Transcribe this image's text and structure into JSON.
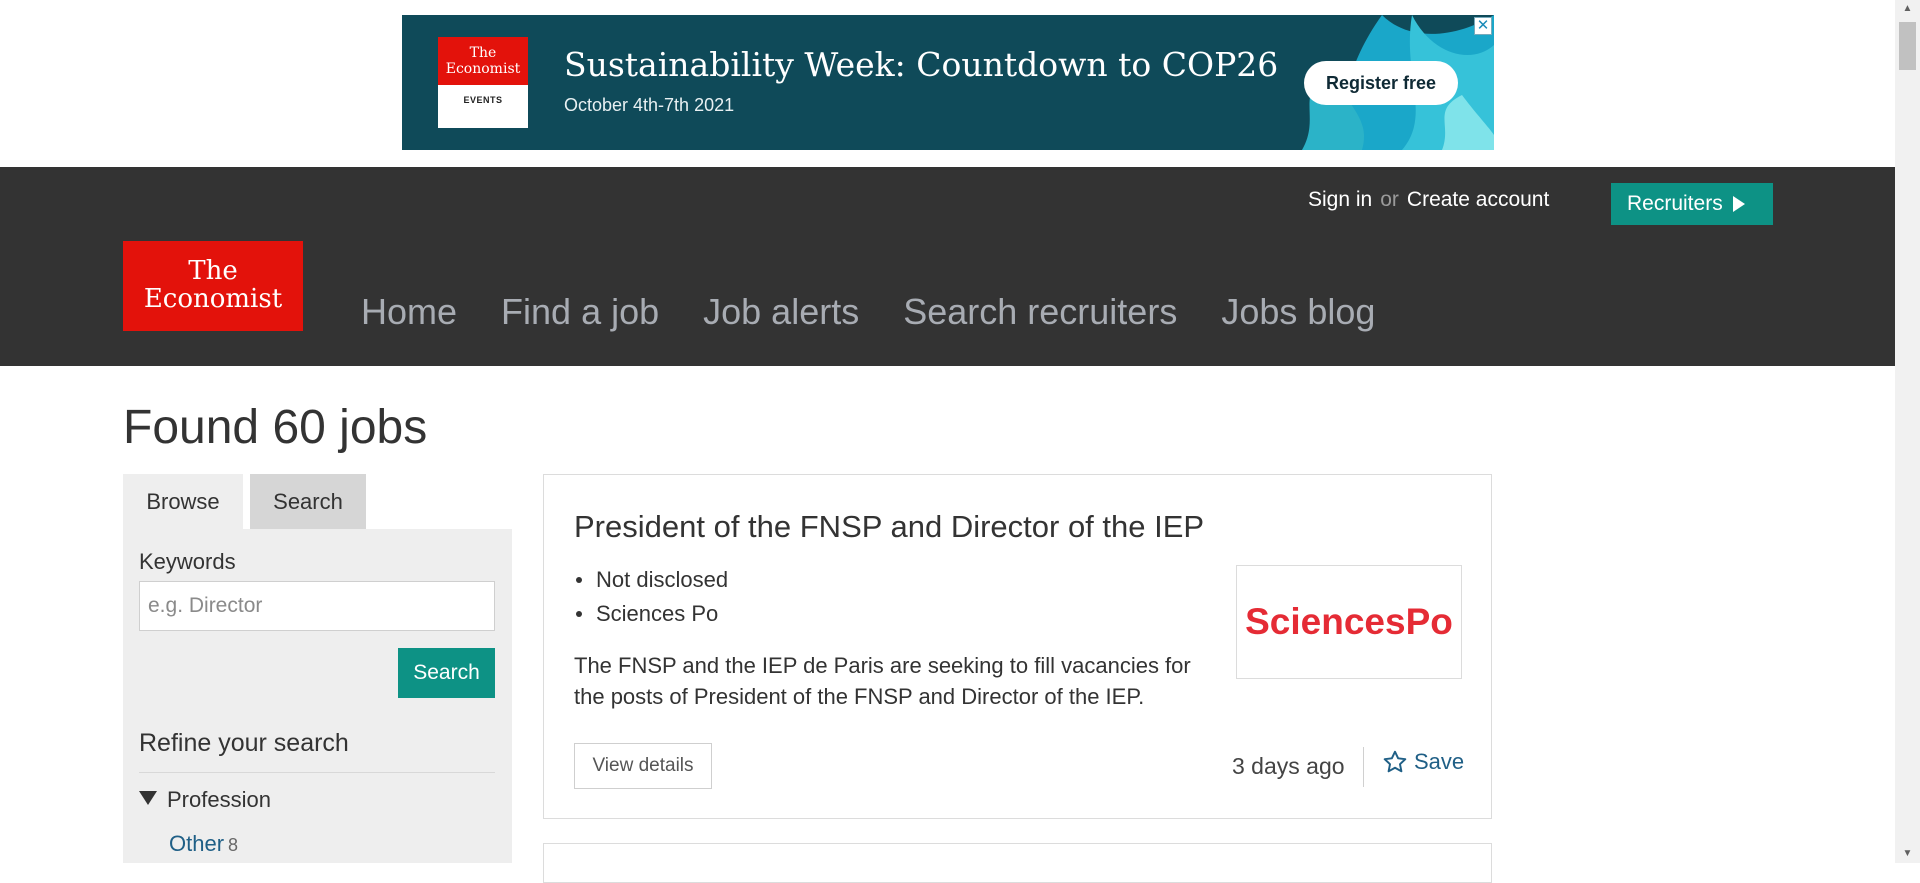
{
  "ad": {
    "brand_line1": "The",
    "brand_line2": "Economist",
    "brand_sub": "EVENTS",
    "title": "Sustainability Week: Countdown to COP26",
    "subtitle": "October 4th-7th 2021",
    "cta": "Register free",
    "close": "✕"
  },
  "header": {
    "sign_in": "Sign in",
    "or": "or",
    "create_account": "Create account",
    "recruiters": "Recruiters",
    "logo_line1": "The",
    "logo_line2": "Economist",
    "nav": [
      "Home",
      "Find a job",
      "Job alerts",
      "Search recruiters",
      "Jobs blog"
    ]
  },
  "main": {
    "found": "Found 60 jobs"
  },
  "sidebar": {
    "tabs": [
      "Browse",
      "Search"
    ],
    "keywords_label": "Keywords",
    "keywords_placeholder": "e.g. Director",
    "search_button": "Search",
    "refine_title": "Refine your search",
    "profession_label": "Profession",
    "other_label": "Other",
    "other_count": "8"
  },
  "job": {
    "title": "President of the FNSP and Director of the IEP",
    "salary": "Not disclosed",
    "employer": "Sciences Po",
    "description": "The FNSP and the IEP de Paris are seeking to fill vacancies for the posts of President of the FNSP and Director of the IEP.",
    "logo_text": "SciencesPo",
    "view_details": "View details",
    "posted": "3 days ago",
    "save": "Save"
  },
  "colors": {
    "header_bg": "#333333",
    "accent_teal": "#0d9285",
    "economist_red": "#e3120b",
    "link_blue": "#1f5f86",
    "sciencespo_red": "#e52b35"
  },
  "icons": {
    "star": "star-outline-icon",
    "close": "close-icon",
    "play": "play-triangle-icon"
  }
}
